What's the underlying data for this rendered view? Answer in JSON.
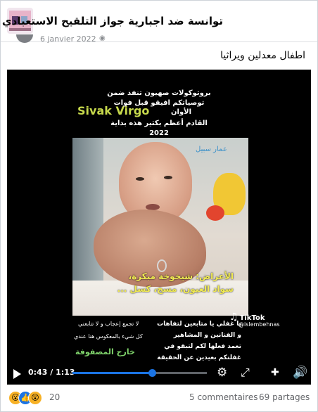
{
  "group": {
    "title": "توانسة ضد اجبارية جواز التلقيح الاستعبادي"
  },
  "post": {
    "meta_date": "6 janvier 2022",
    "text": "اطفال معدلين ويراثيا"
  },
  "video": {
    "overlay_top": [
      "بروتوكولات صهيون تنفذ ضمن",
      "توصياتكم افيقو قبل فوات",
      "القادم أعظم بكثير هذه بداية",
      "2022"
    ],
    "brand_text": "Sivak Virgo",
    "awan_text": "الأوان",
    "watermark": "عمار سبيل",
    "caption_lines": [
      "الأعراض: شيخوخة مبكرة،",
      "سواد العيون، مسخ، كسل ..."
    ],
    "tiktok_logo": "TikTok",
    "tiktok_handle": "@islembehnas",
    "bottom_left_lines": [
      "لا تجمع إعجاب و لا تتابعني",
      "كل شيء بالمعكوس هنا عندي"
    ],
    "bottom_left_green": "خارج المصفوفة",
    "bottom_right_lines": [
      "يا غفلي يا متابعين لتفاهات",
      "و الفنانين و المشاهير",
      "تعمد فعلها لكم لتبقو في",
      "غفلتكم بعيدين عن الحقيقة"
    ],
    "time_current": "0:43",
    "time_total": "1:13",
    "progress": 0.59,
    "icons": {
      "play": "play-icon",
      "settings": "gear-icon",
      "fullscreen": "fullscreen-icon",
      "volume": "volume-icon"
    }
  },
  "footer": {
    "reaction_count": "20",
    "reaction_emojis": [
      "😮",
      "👍",
      "😲"
    ],
    "comments": "5 commentaires",
    "shares": "69 partages"
  },
  "colors": {
    "accent": "#1b74e4",
    "caption_yellow": "#f0ea52",
    "green_text": "#7fd36b",
    "brand_green": "#c7d94c"
  }
}
